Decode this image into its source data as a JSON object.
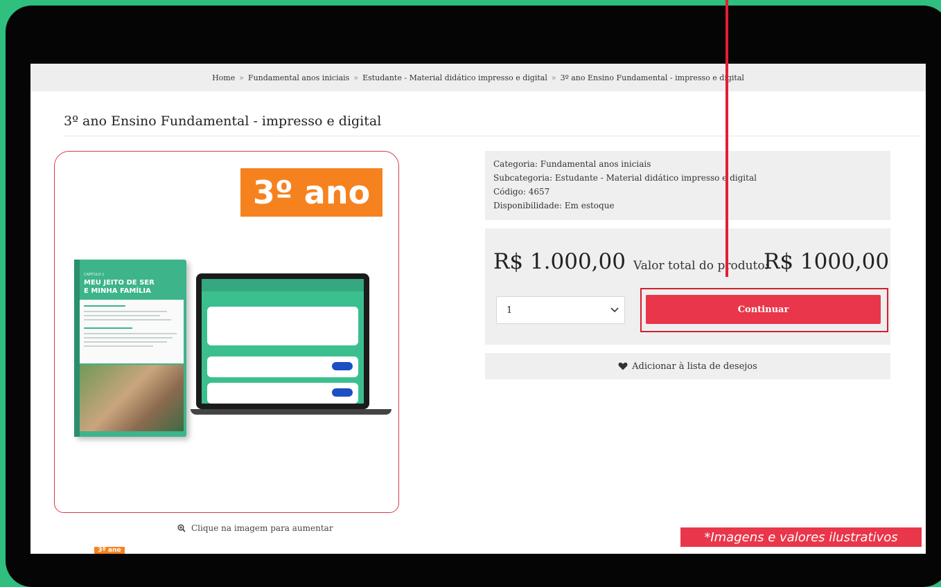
{
  "breadcrumb": {
    "items": [
      "Home",
      "Fundamental anos iniciais",
      "Estudante - Material didático impresso e digital",
      "3º ano Ensino Fundamental - impresso e digital"
    ],
    "separator": "»"
  },
  "product": {
    "title": "3º ano Ensino Fundamental - impresso e digital",
    "image_badge": "3º ano",
    "book_cover": {
      "chapter": "CAPÍTULO 1",
      "title_line1": "MEU JEITO DE SER",
      "title_line2": "E MINHA FAMÍLIA"
    },
    "zoom_hint": "Clique na imagem para aumentar",
    "thumb_label": "3º ano"
  },
  "info": {
    "categoria": "Categoria: Fundamental anos iniciais",
    "subcategoria": "Subcategoria: Estudante - Material didático impresso e digital",
    "codigo": "Código: 4657",
    "disponibilidade": "Disponibilidade: Em estoque"
  },
  "pricing": {
    "price": "R$ 1.000,00",
    "total_label": "Valor total do produto:",
    "total_value": "R$ 1000,00",
    "quantity": "1",
    "continue_label": "Continuar"
  },
  "wishlist": {
    "label": "Adicionar à lista de desejos"
  },
  "disclaimer": "*Imagens e valores ilustrativos",
  "colors": {
    "background": "#2fbf7f",
    "accent_red": "#e9364a",
    "highlight_frame": "#d41f2d",
    "badge_orange": "#f6821f"
  },
  "icons": [
    "zoom-in-icon",
    "heart-icon",
    "chevron-down-icon"
  ]
}
